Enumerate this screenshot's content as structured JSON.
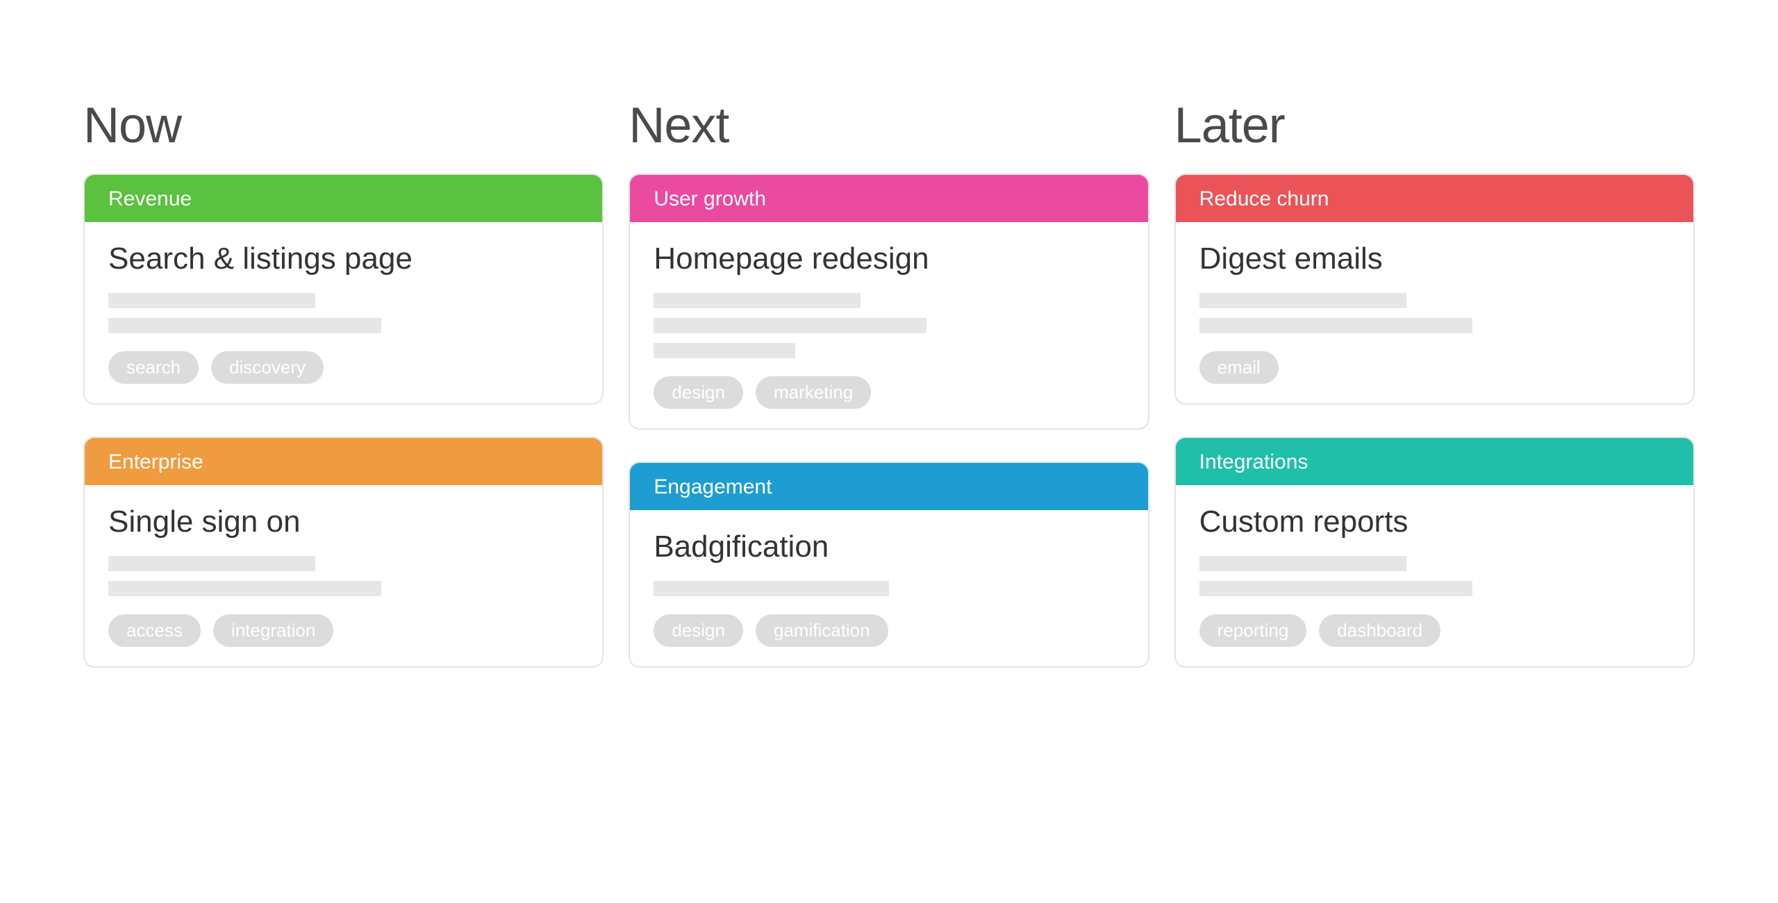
{
  "columns": [
    {
      "id": "now",
      "title": "Now",
      "cards": [
        {
          "id": "revenue",
          "category": "Revenue",
          "color": "green",
          "title": "Search & listings page",
          "skeleton_widths": [
            44,
            58
          ],
          "tags": [
            "search",
            "discovery"
          ]
        },
        {
          "id": "enterprise",
          "category": "Enterprise",
          "color": "orange",
          "title": "Single sign on",
          "skeleton_widths": [
            44,
            58
          ],
          "tags": [
            "access",
            "integration"
          ]
        }
      ]
    },
    {
      "id": "next",
      "title": "Next",
      "cards": [
        {
          "id": "user-growth",
          "category": "User growth",
          "color": "pink",
          "title": "Homepage redesign",
          "skeleton_widths": [
            44,
            58,
            30
          ],
          "tags": [
            "design",
            "marketing"
          ]
        },
        {
          "id": "engagement",
          "category": "Engagement",
          "color": "blue",
          "title": "Badgification",
          "skeleton_widths": [
            50
          ],
          "tags": [
            "design",
            "gamification"
          ]
        }
      ]
    },
    {
      "id": "later",
      "title": "Later",
      "cards": [
        {
          "id": "reduce-churn",
          "category": "Reduce churn",
          "color": "red",
          "title": "Digest emails",
          "skeleton_widths": [
            44,
            58
          ],
          "tags": [
            "email"
          ]
        },
        {
          "id": "integrations",
          "category": "Integrations",
          "color": "teal",
          "title": "Custom reports",
          "skeleton_widths": [
            44,
            58
          ],
          "tags": [
            "reporting",
            "dashboard"
          ]
        }
      ]
    }
  ]
}
